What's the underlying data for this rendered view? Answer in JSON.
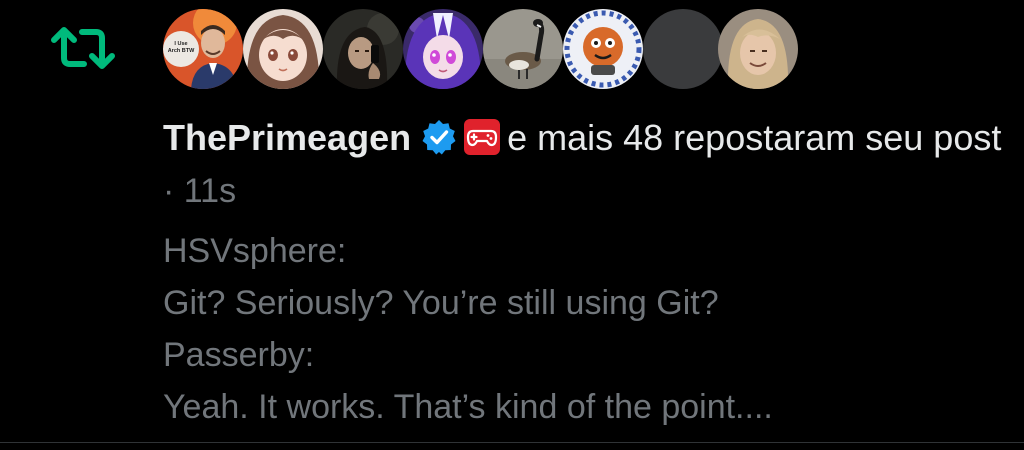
{
  "notification": {
    "type_icon": "repost-icon",
    "avatars": [
      {
        "name": "avatar-1",
        "icon": "person-avatar",
        "caption": "I Use Arch BTW"
      },
      {
        "name": "avatar-2",
        "icon": "anime-girl-avatar"
      },
      {
        "name": "avatar-3",
        "icon": "person-phone-avatar"
      },
      {
        "name": "avatar-4",
        "icon": "anime-character-avatar"
      },
      {
        "name": "avatar-5",
        "icon": "goose-avatar"
      },
      {
        "name": "avatar-6",
        "icon": "cartoon-avatar"
      },
      {
        "name": "avatar-7",
        "icon": "blank-avatar"
      },
      {
        "name": "avatar-8",
        "icon": "person-avatar"
      }
    ],
    "username": "ThePrimeagen",
    "verified_icon": "verified-badge-icon",
    "emoji_icon": "gamepad-icon",
    "action_text": "e mais 48 repostaram seu post",
    "separator": "·",
    "time": "11s"
  },
  "post": {
    "lines": [
      "HSVsphere:",
      "Git? Seriously? You’re still using Git?",
      "Passerby:",
      "Yeah. It works. That’s kind of the point...."
    ]
  },
  "colors": {
    "background": "#000000",
    "primary_text": "#e7e9ea",
    "secondary_text": "#71767b",
    "repost_green": "#00ba7c",
    "verified_blue": "#1d9bf0",
    "divider": "#2f3336"
  }
}
